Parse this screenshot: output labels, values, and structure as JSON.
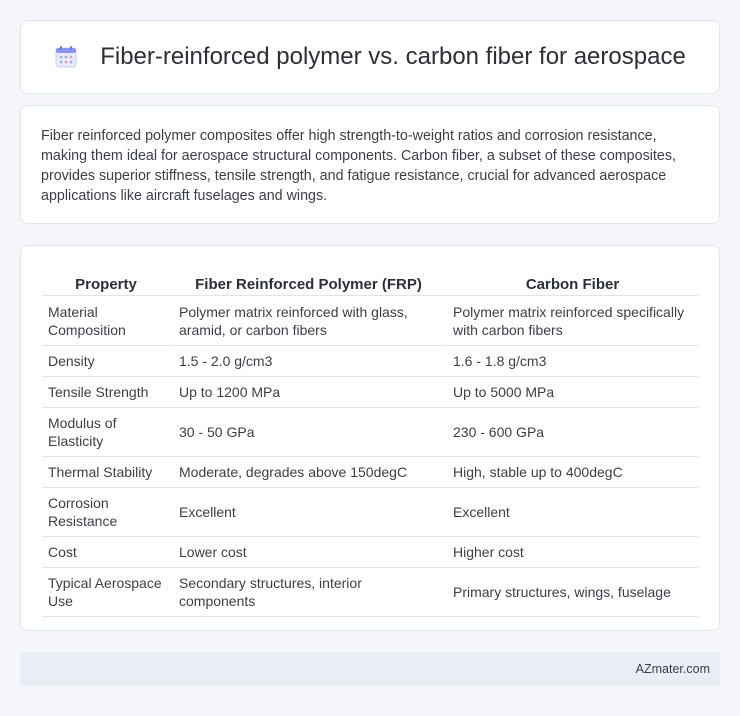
{
  "header": {
    "title": "Fiber-reinforced polymer vs. carbon fiber for aerospace",
    "icon": "calendar-icon"
  },
  "intro": {
    "text": "Fiber reinforced polymer composites offer high strength-to-weight ratios and corrosion resistance, making them ideal for aerospace structural components. Carbon fiber, a subset of these composites, provides superior stiffness, tensile strength, and fatigue resistance, crucial for advanced aerospace applications like aircraft fuselages and wings."
  },
  "table": {
    "headers": [
      "Property",
      "Fiber Reinforced Polymer (FRP)",
      "Carbon Fiber"
    ],
    "rows": [
      [
        "Material Composition",
        "Polymer matrix reinforced with glass, aramid, or carbon fibers",
        "Polymer matrix reinforced specifically with carbon fibers"
      ],
      [
        "Density",
        "1.5 - 2.0 g/cm3",
        "1.6 - 1.8 g/cm3"
      ],
      [
        "Tensile Strength",
        "Up to 1200 MPa",
        "Up to 5000 MPa"
      ],
      [
        "Modulus of Elasticity",
        "30 - 50 GPa",
        "230 - 600 GPa"
      ],
      [
        "Thermal Stability",
        "Moderate, degrades above 150degC",
        "High, stable up to 400degC"
      ],
      [
        "Corrosion Resistance",
        "Excellent",
        "Excellent"
      ],
      [
        "Cost",
        "Lower cost",
        "Higher cost"
      ],
      [
        "Typical Aerospace Use",
        "Secondary structures, interior components",
        "Primary structures, wings, fuselage"
      ]
    ]
  },
  "footer": {
    "text": "AZmater.com"
  },
  "colors": {
    "background": "#f4f6fa",
    "card": "#ffffff",
    "footer_bg": "#e9edf6",
    "icon_accent": "#7a86e8"
  }
}
